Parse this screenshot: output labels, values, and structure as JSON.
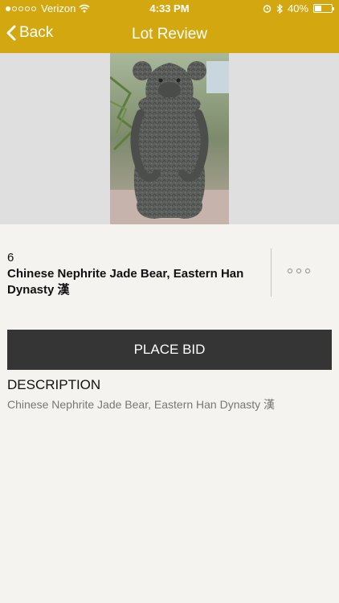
{
  "status": {
    "carrier": "Verizon",
    "time": "4:33 PM",
    "battery": "40%",
    "battery_level": 0.4,
    "signal_dots_filled": 1,
    "signal_dots_total": 5
  },
  "nav": {
    "back_label": "Back",
    "title": "Lot Review"
  },
  "lot": {
    "number": "6",
    "title": "Chinese Nephrite Jade Bear, Eastern Han Dynasty 漢"
  },
  "actions": {
    "place_bid": "PLACE BID"
  },
  "description": {
    "heading": "DESCRIPTION",
    "text": "Chinese Nephrite Jade Bear, Eastern Han Dynasty 漢"
  },
  "colors": {
    "brand": "#d3a710",
    "button": "#353535",
    "background": "#f5f3ef"
  }
}
